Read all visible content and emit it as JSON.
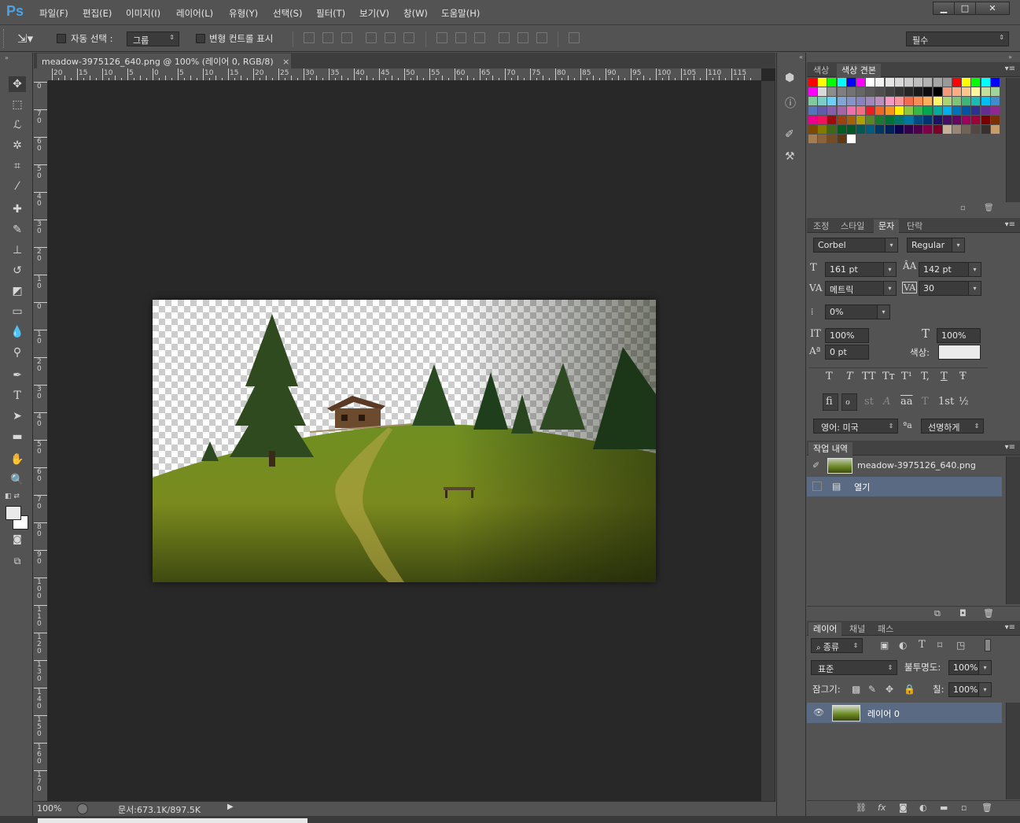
{
  "app": {
    "logo": "Ps"
  },
  "menu": [
    "파일(F)",
    "편집(E)",
    "이미지(I)",
    "레이어(L)",
    "유형(Y)",
    "선택(S)",
    "필터(T)",
    "보기(V)",
    "창(W)",
    "도움말(H)"
  ],
  "window_controls": {
    "minimize": "▁",
    "maximize": "□",
    "close": "✕"
  },
  "options": {
    "auto_select_label": "자동 선택 :",
    "auto_select_value": "그룹",
    "transform_controls_label": "변형 컨트롤 표시",
    "workspace": "필수"
  },
  "document": {
    "tab_title": "meadow-3975126_640.png @ 100% (레이어 0, RGB/8)",
    "tab_close": "×",
    "zoom": "100%",
    "doc_info": "문서:673.1K/897.5K"
  },
  "ruler_h": [
    "20",
    "15",
    "10",
    "5",
    "0",
    "5",
    "10",
    "15",
    "20",
    "25",
    "30",
    "35",
    "40",
    "45",
    "50",
    "55",
    "60",
    "65",
    "70",
    "75",
    "80",
    "85",
    "90",
    "95",
    "100",
    "105",
    "110",
    "115"
  ],
  "ruler_v": [
    "0",
    "70",
    "60",
    "50",
    "40",
    "30",
    "20",
    "10",
    "0",
    "10",
    "20",
    "30",
    "40",
    "50",
    "60",
    "70",
    "80",
    "90",
    "100",
    "110",
    "120",
    "130",
    "140",
    "150",
    "160",
    "170"
  ],
  "swatches_panel": {
    "tab_color": "색상",
    "tab_swatches": "색상 견본"
  },
  "character_panel": {
    "tabs": [
      "조정",
      "스타일",
      "문자",
      "단락"
    ],
    "font_family": "Corbel",
    "font_style": "Regular",
    "font_size": "161 pt",
    "leading": "142 pt",
    "kerning": "메트릭",
    "tracking": "30",
    "tsume": "0%",
    "vertical_scale": "100%",
    "horizontal_scale": "100%",
    "baseline_shift": "0 pt",
    "color_label": "색상:",
    "language": "영어: 미국",
    "antialias": "선명하게",
    "aa_label": "ªa",
    "style_glyphs": [
      "T",
      "T",
      "TT",
      "Tт",
      "T¹",
      "T,",
      "T",
      "Ŧ"
    ],
    "ot_glyphs": [
      "fi",
      "ℴ",
      "st",
      "A",
      "aa",
      "T",
      "1st",
      "½"
    ]
  },
  "history_panel": {
    "title": "작업 내역",
    "snapshot": "meadow-3975126_640.png",
    "steps": [
      "열기"
    ]
  },
  "layers_panel": {
    "tabs": [
      "레이어",
      "채널",
      "패스"
    ],
    "filter_kind": "종류",
    "blend_mode": "표준",
    "opacity_label": "불투명도:",
    "opacity": "100%",
    "lock_label": "잠그기:",
    "fill_label": "칠:",
    "fill": "100%",
    "layers": [
      "레이어 0"
    ]
  },
  "colors": {
    "accent": "#4aa3e6",
    "selected_row": "#5a6a82",
    "canvas_bg": "#282828"
  }
}
